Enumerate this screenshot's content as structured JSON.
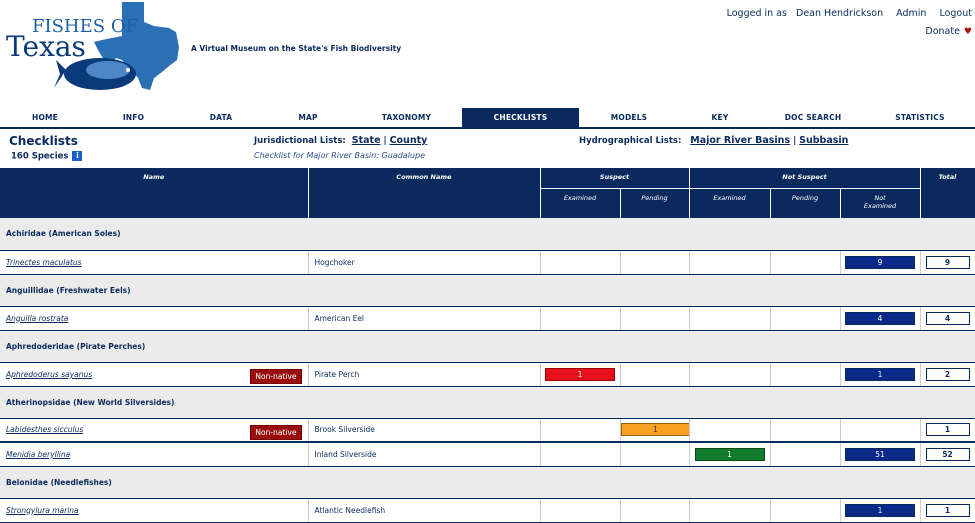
{
  "logo": {
    "line1": "FISHES OF",
    "line2": "Texas"
  },
  "tagline": "A Virtual Museum on the State's Fish Biodiversity",
  "user": {
    "logged_in_label": "Logged in as",
    "name": "Dean Hendrickson",
    "admin": "Admin",
    "logout": "Logout",
    "donate": "Donate",
    "heart": "♥"
  },
  "nav": {
    "tabs": [
      {
        "label": "HOME"
      },
      {
        "label": "INFO"
      },
      {
        "label": "DATA"
      },
      {
        "label": "MAP"
      },
      {
        "label": "TAXONOMY"
      },
      {
        "label": "CHECKLISTS"
      },
      {
        "label": "MODELS"
      },
      {
        "label": "KEY"
      },
      {
        "label": "DOC SEARCH"
      },
      {
        "label": "STATISTICS"
      }
    ],
    "active": "CHECKLISTS"
  },
  "page": {
    "title": "Checklists",
    "species_count": "160 Species",
    "info_icon": "info-icon",
    "jurisdictional_label": "Jurisdictional Lists:",
    "state_link": "State",
    "county_link": "County",
    "separator": "|",
    "checklist_for": "Checklist for Major River Basin: Guadalupe",
    "hydro_label": "Hydrographical Lists:",
    "major_link": "Major River Basins",
    "subbasin_link": "Subbasin"
  },
  "table": {
    "headers": {
      "name": "Name",
      "common": "Common Name",
      "suspect": "Suspect",
      "not_suspect": "Not Suspect",
      "total": "Total",
      "examined": "Examined",
      "pending": "Pending",
      "ns_examined": "Examined",
      "ns_pending": "Pending",
      "not_examined_1": "Not",
      "not_examined_2": "Examined"
    },
    "families": [
      {
        "name": "Achiridae (American Soles)",
        "species": [
          {
            "sci": "Trinectes maculatus",
            "common": "Hogchoker",
            "nonnative": "",
            "s_exam": "",
            "s_pend": "",
            "ns_exam": "",
            "ns_pend": "",
            "ns_notexam": "9",
            "total": "9"
          }
        ]
      },
      {
        "name": "Anguillidae (Freshwater Eels)",
        "species": [
          {
            "sci": "Anguilla rostrata",
            "common": "American Eel",
            "nonnative": "",
            "s_exam": "",
            "s_pend": "",
            "ns_exam": "",
            "ns_pend": "",
            "ns_notexam": "4",
            "total": "4"
          }
        ]
      },
      {
        "name": "Aphredoderidae (Pirate Perches)",
        "species": [
          {
            "sci": "Aphredoderus sayanus",
            "common": "Pirate Perch",
            "nonnative": "Non-native",
            "s_exam": "1",
            "s_pend": "",
            "ns_exam": "",
            "ns_pend": "",
            "ns_notexam": "1",
            "total": "2"
          }
        ]
      },
      {
        "name": "Atherinopsidae (New World Silversides)",
        "species": [
          {
            "sci": "Labidesthes sicculus",
            "common": "Brook Silverside",
            "nonnative": "Non-native",
            "s_exam": "",
            "s_pend": "1",
            "ns_exam": "",
            "ns_pend": "",
            "ns_notexam": "",
            "total": "1",
            "highlight": "pink"
          },
          {
            "sci": "Menidia beryllina",
            "common": "Inland Silverside",
            "nonnative": "",
            "s_exam": "",
            "s_pend": "",
            "ns_exam": "1",
            "ns_pend": "",
            "ns_notexam": "51",
            "total": "52"
          }
        ]
      },
      {
        "name": "Belonidae (Needlefishes)",
        "species": [
          {
            "sci": "Strongylura marina",
            "common": "Atlantic Needlefish",
            "nonnative": "",
            "s_exam": "",
            "s_pend": "",
            "ns_exam": "",
            "ns_pend": "",
            "ns_notexam": "1",
            "total": "1"
          }
        ]
      }
    ]
  },
  "colors": {
    "navy": "#0a2a5e",
    "suspect_examined": "#e8101a",
    "suspect_pending": "#f7a022",
    "ns_examined": "#117a2a",
    "ns_not_examined": "#0a2a8a",
    "nonnative": "#9a0e0e",
    "highlight_row": "#f8c8d0"
  }
}
